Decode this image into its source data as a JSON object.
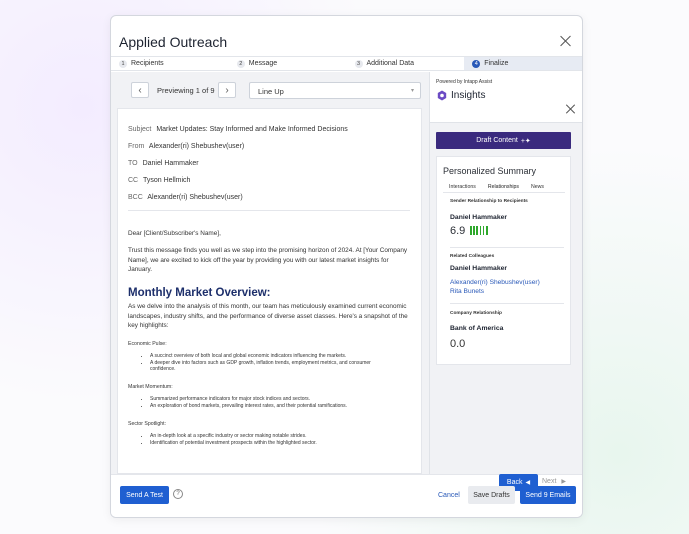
{
  "dialog": {
    "title": "Applied Outreach"
  },
  "steps": [
    {
      "num": "1",
      "label": "Recipients"
    },
    {
      "num": "2",
      "label": "Message"
    },
    {
      "num": "3",
      "label": "Additional Data"
    },
    {
      "num": "4",
      "label": "Finalize",
      "active": true
    }
  ],
  "preview": {
    "prev": "‹",
    "text": "Previewing 1 of 9",
    "next": "›",
    "template_select": "Line Up"
  },
  "email": {
    "subject_label": "Subject",
    "subject": "Market Updates: Stay Informed and Make Informed Decisions",
    "from_label": "From",
    "from": "Alexander(ri) Shebushev(user)",
    "to_label": "TO",
    "to": "Daniel Hammaker",
    "cc_label": "CC",
    "cc": "Tyson Hellmich",
    "bcc_label": "BCC",
    "bcc": "Alexander(ri) Shebushev(user)",
    "greeting": "Dear [Client/Subscriber's Name],",
    "intro": "Trust this message finds you well as we step into the promising horizon of 2024. At [Your Company Name], we are excited to kick off the year by providing you with our latest market insights for January.",
    "heading": "Monthly Market Overview:",
    "overview": "As we delve into the analysis of this month, our team has meticulously examined current economic landscapes, industry shifts, and the performance of diverse asset classes. Here's a snapshot of the key highlights:",
    "sections": [
      {
        "title": "Economic Pulse:",
        "items": [
          "A succinct overview of both local and global economic indicators influencing the markets.",
          "A deeper dive into factors such as GDP growth, inflation trends, employment metrics, and consumer confidence."
        ]
      },
      {
        "title": "Market Momentum:",
        "items": [
          "Summarized performance indicators for major stock indices and sectors.",
          "An exploration of bond markets, prevailing interest rates, and their potential ramifications."
        ]
      },
      {
        "title": "Sector Spotlight:",
        "items": [
          "An in-depth look at a specific industry or sector making notable strides.",
          "Identification of potential investment prospects within the highlighted sector."
        ]
      }
    ]
  },
  "insights": {
    "powered_by": "Powered by Intapp Assist",
    "title": "Insights",
    "draft_button": "Draft Content",
    "draft_icon": "+✦",
    "summary_title": "Personalized Summary",
    "tabs": [
      "Interactions",
      "Relationships",
      "News"
    ],
    "active_tab": "Relationships",
    "sender_label": "Sender Relationship to Recipients",
    "sender_name": "Daniel Hammaker",
    "score": "6.9",
    "score_bars": 6,
    "related_label": "Related Colleagues",
    "related_name": "Daniel Hammaker",
    "colleagues": [
      "Alexander(ri) Shebushev(user)",
      "Rita Bunets"
    ],
    "company_label": "Company Relationship",
    "company_name": "Bank of America",
    "company_score": "0.0"
  },
  "footer": {
    "back": "Back",
    "next": "Next",
    "send_test": "Send A Test",
    "help": "?",
    "cancel": "Cancel",
    "save_drafts": "Save Drafts",
    "send_emails": "Send 9 Emails"
  },
  "colors": {
    "primary": "#1f5fd1",
    "draft_button": "#3a2a7e",
    "score_bar": "#2fa82c",
    "heading": "#1d2f6b"
  }
}
